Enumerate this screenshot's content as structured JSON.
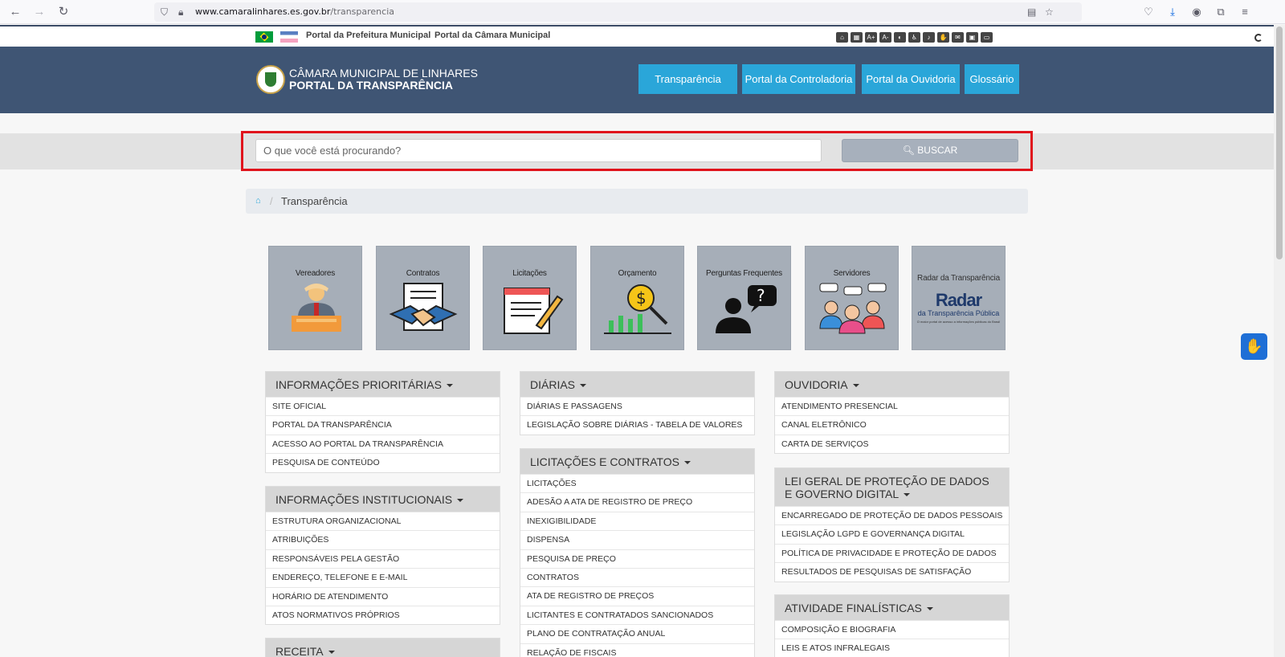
{
  "browser": {
    "url_host": "www.camaralinhares.es.gov.br",
    "url_path": "/transparencia"
  },
  "top_strip": {
    "link1": "Portal da Prefeitura Municipal",
    "link2": "Portal da Câmara Municipal"
  },
  "header": {
    "title": "CÂMARA MUNICIPAL DE LINHARES",
    "subtitle": "PORTAL DA TRANSPARÊNCIA",
    "nav": [
      "Transparência",
      "Portal da Controladoria",
      "Portal da Ouvidoria",
      "Glossário"
    ]
  },
  "search": {
    "placeholder": "O que você está procurando?",
    "button": "BUSCAR"
  },
  "breadcrumb": {
    "current": "Transparência"
  },
  "tiles": [
    "Vereadores",
    "Contratos",
    "Licitações",
    "Orçamento",
    "Perguntas Frequentes",
    "Servidores",
    "Radar da Transparência"
  ],
  "radar": {
    "logo_word": "Radar",
    "logo_sub": "da Transparência Pública",
    "logo_tiny": "O maior portal de acesso a informações públicas do Brasil"
  },
  "panels": {
    "prioritarias": {
      "title": "INFORMAÇÕES PRIORITÁRIAS",
      "items": [
        "SITE OFICIAL",
        "PORTAL DA TRANSPARÊNCIA",
        "ACESSO AO PORTAL DA TRANSPARÊNCIA",
        "PESQUISA DE CONTEÚDO"
      ]
    },
    "institucionais": {
      "title": "INFORMAÇÕES INSTITUCIONAIS",
      "items": [
        "ESTRUTURA ORGANIZACIONAL",
        "ATRIBUIÇÕES",
        "RESPONSÁVEIS PELA GESTÃO",
        "ENDEREÇO, TELEFONE E E-MAIL",
        "HORÁRIO DE ATENDIMENTO",
        "ATOS NORMATIVOS PRÓPRIOS"
      ]
    },
    "receita": {
      "title": "RECEITA",
      "items": []
    },
    "diarias": {
      "title": "DIÁRIAS",
      "items": [
        "DIÁRIAS E PASSAGENS",
        "LEGISLAÇÃO SOBRE DIÁRIAS - TABELA DE VALORES"
      ]
    },
    "licitacoes": {
      "title": "LICITAÇÕES E CONTRATOS",
      "items": [
        "LICITAÇÕES",
        "ADESÃO A ATA DE REGISTRO DE PREÇO",
        "INEXIGIBILIDADE",
        "DISPENSA",
        "PESQUISA DE PREÇO",
        "CONTRATOS",
        "ATA DE REGISTRO DE PREÇOS",
        "LICITANTES E CONTRATADOS SANCIONADOS",
        "PLANO DE CONTRATAÇÃO ANUAL",
        "RELAÇÃO DE FISCAIS"
      ]
    },
    "ouvidoria": {
      "title": "OUVIDORIA",
      "items": [
        "ATENDIMENTO PRESENCIAL",
        "CANAL ELETRÔNICO",
        "CARTA DE SERVIÇOS"
      ]
    },
    "lgpd": {
      "title": "LEI GERAL DE PROTEÇÃO DE DADOS E GOVERNO DIGITAL",
      "items": [
        "ENCARREGADO DE PROTEÇÃO DE DADOS PESSOAIS",
        "LEGISLAÇÃO LGPD E GOVERNANÇA DIGITAL",
        "POLÍTICA DE PRIVACIDADE E PROTEÇÃO DE DADOS",
        "RESULTADOS DE PESQUISAS DE SATISFAÇÃO"
      ]
    },
    "finalisticas": {
      "title": "ATIVIDADE FINALÍSTICAS",
      "items": [
        "COMPOSIÇÃO E BIOGRAFIA",
        "LEIS E ATOS INFRALEGAIS"
      ]
    }
  },
  "colors": {
    "header_bg": "#3f5574",
    "nav_bg": "#2aa6d9",
    "highlight": "#e0141c"
  }
}
